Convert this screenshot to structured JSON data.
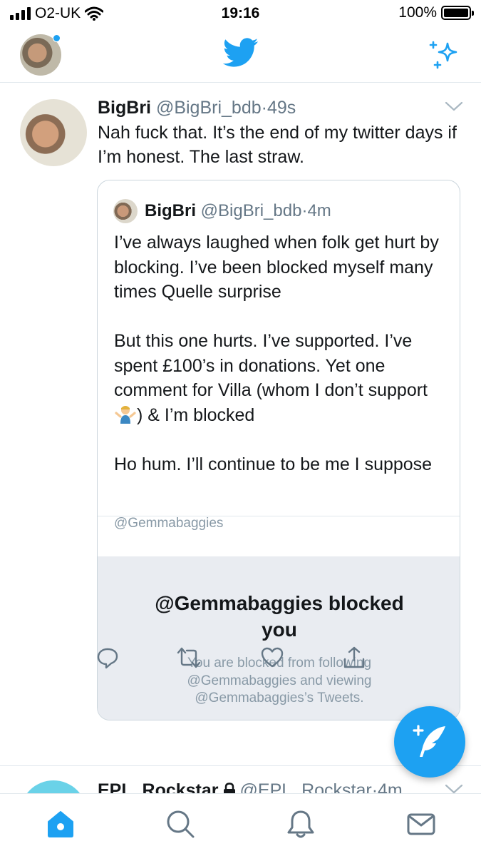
{
  "status_bar": {
    "carrier": "O2-UK",
    "time": "19:16",
    "battery": "100%"
  },
  "top_nav": {
    "logo": "twitter-bird-icon",
    "sparkle": "sparkle-icon"
  },
  "tweet": {
    "name": "BigBri",
    "handle": "@BigBri_bdb",
    "separator": "·",
    "time": "49s",
    "text": "Nah fuck that. It’s the end of my twitter days if I’m honest. The last straw.",
    "quoted": {
      "name": "BigBri",
      "handle": "@BigBri_bdb",
      "separator": "·",
      "time": "4m",
      "para1": "I’ve always laughed when folk get hurt by blocking. I’ve been blocked myself many times Quelle surprise",
      "para2_before": "But this one hurts. I’ve supported. I’ve spent £100’s in donations. Yet one comment for Villa (whom I don’t support ",
      "para2_after": ") & I’m blocked",
      "para3": "Ho hum. I’ll continue to be me I suppose",
      "embedded_handle": "@Gemmabaggies",
      "blocked_title": "@Gemmabaggies blocked you",
      "blocked_subtitle": "You are blocked from following @Gemmabaggies and viewing @Gemmabaggies’s Tweets."
    },
    "actions": [
      "reply-icon",
      "retweet-icon",
      "like-icon",
      "share-icon"
    ]
  },
  "next_tweet": {
    "name": "EPL_Rockstar",
    "handle": "@EPL_Rockstar",
    "separator": "·",
    "time": "4m"
  },
  "tab_bar": [
    "home-icon",
    "search-icon",
    "notifications-icon",
    "messages-icon"
  ],
  "colors": {
    "accent": "#1da1f2",
    "muted": "#657786",
    "blocked_bg": "#e9ecf1"
  }
}
